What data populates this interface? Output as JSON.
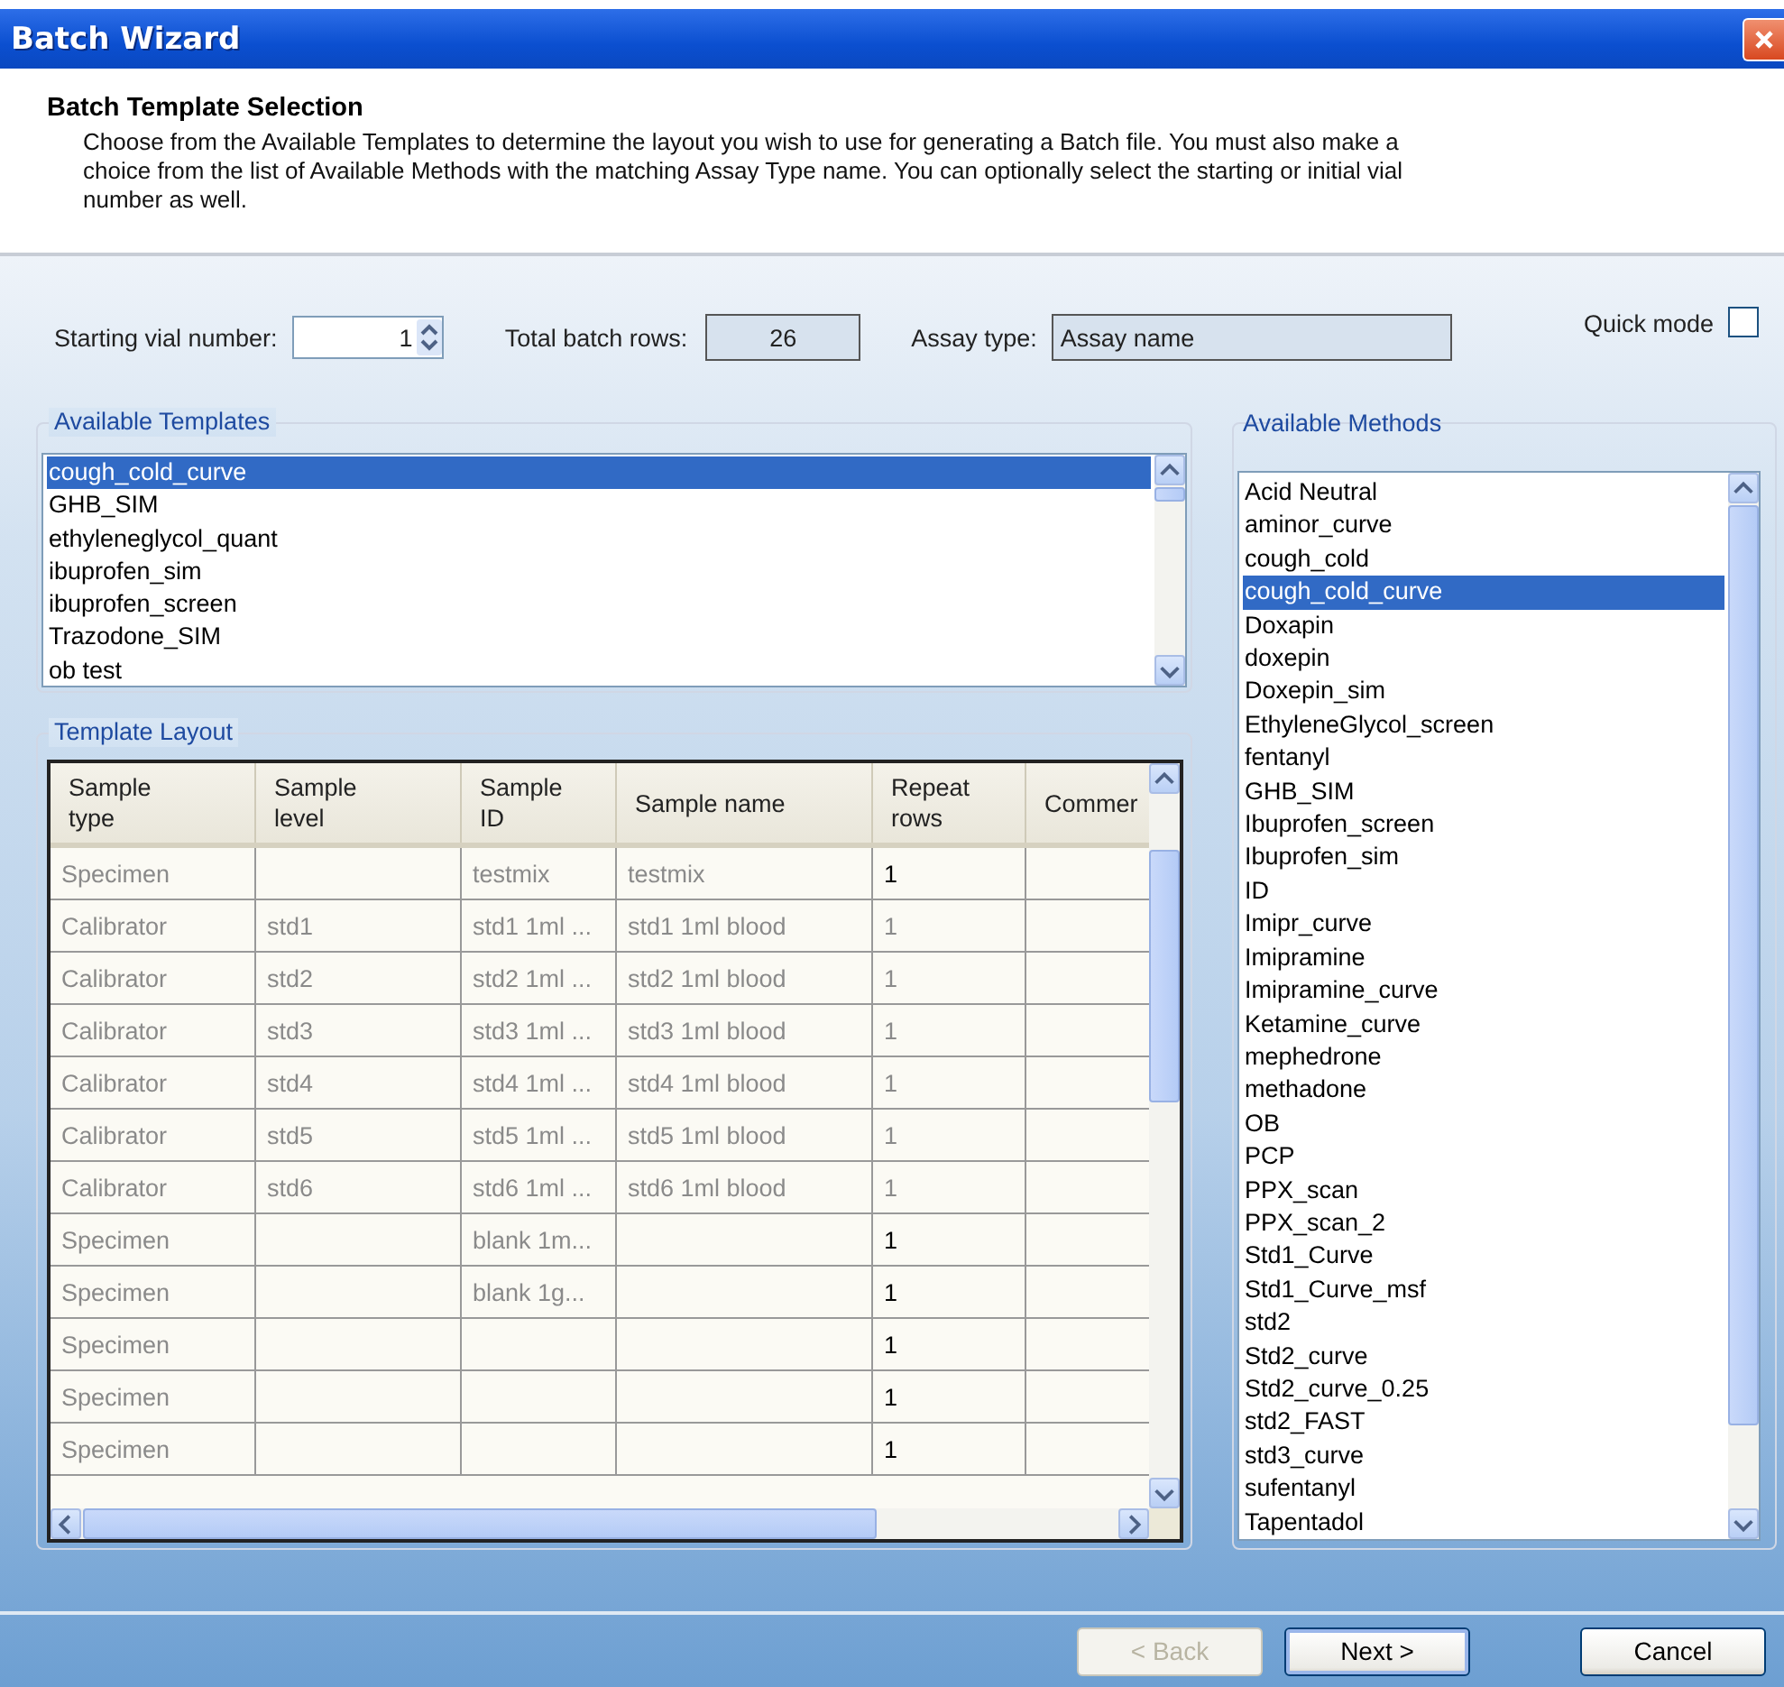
{
  "window": {
    "title": "Batch Wizard"
  },
  "header": {
    "title": "Batch Template Selection",
    "description": "Choose from the Available Templates to determine the layout you wish to use for generating a Batch file.  You must also make a choice from the list of Available Methods with the matching Assay Type name.  You can optionally select the starting or initial vial number as well."
  },
  "settings": {
    "starting_vial_label": "Starting vial number:",
    "starting_vial": "1",
    "total_rows_label": "Total batch rows:",
    "total_rows": "26",
    "assay_type_label": "Assay type:",
    "assay_type": "Assay name",
    "quick_mode_label": "Quick mode",
    "quick_mode_checked": false
  },
  "templates": {
    "label": "Available Templates",
    "items": [
      {
        "label": "cough_cold_curve",
        "selected": true
      },
      {
        "label": "GHB_SIM",
        "selected": false
      },
      {
        "label": "ethyleneglycol_quant",
        "selected": false
      },
      {
        "label": "ibuprofen_sim",
        "selected": false
      },
      {
        "label": "ibuprofen_screen",
        "selected": false
      },
      {
        "label": "Trazodone_SIM",
        "selected": false
      },
      {
        "label": "ob test",
        "selected": false
      }
    ]
  },
  "template_layout": {
    "label": "Template Layout",
    "columns": [
      "Sample type",
      "Sample level",
      "Sample ID",
      "Sample name",
      "Repeat rows",
      "Commer"
    ],
    "rows": [
      {
        "sample_type": "Specimen",
        "sample_id": "testmix",
        "sample_name": "testmix",
        "repeat_rows": "1",
        "editable": true
      },
      {
        "sample_type": "Calibrator",
        "sample_level": "std1",
        "sample_id": "std1 1ml ...",
        "sample_name": "std1 1ml blood",
        "repeat_rows": "1",
        "editable": false
      },
      {
        "sample_type": "Calibrator",
        "sample_level": "std2",
        "sample_id": "std2 1ml ...",
        "sample_name": "std2 1ml blood",
        "repeat_rows": "1",
        "editable": false
      },
      {
        "sample_type": "Calibrator",
        "sample_level": "std3",
        "sample_id": "std3 1ml ...",
        "sample_name": "std3 1ml blood",
        "repeat_rows": "1",
        "editable": false
      },
      {
        "sample_type": "Calibrator",
        "sample_level": "std4",
        "sample_id": "std4 1ml ...",
        "sample_name": "std4 1ml blood",
        "repeat_rows": "1",
        "editable": false
      },
      {
        "sample_type": "Calibrator",
        "sample_level": "std5",
        "sample_id": "std5 1ml ...",
        "sample_name": "std5 1ml blood",
        "repeat_rows": "1",
        "editable": false
      },
      {
        "sample_type": "Calibrator",
        "sample_level": "std6",
        "sample_id": "std6 1ml ...",
        "sample_name": "std6 1ml blood",
        "repeat_rows": "1",
        "editable": false
      },
      {
        "sample_type": "Specimen",
        "sample_id": "blank 1m...",
        "repeat_rows": "1",
        "editable": true
      },
      {
        "sample_type": "Specimen",
        "sample_id": "blank 1g...",
        "repeat_rows": "1",
        "editable": true
      },
      {
        "sample_type": "Specimen",
        "repeat_rows": "1",
        "editable": true
      },
      {
        "sample_type": "Specimen",
        "repeat_rows": "1",
        "editable": true
      },
      {
        "sample_type": "Specimen",
        "repeat_rows": "1",
        "editable": true
      }
    ]
  },
  "methods": {
    "label": "Available Methods",
    "items": [
      {
        "label": "Acid Neutral",
        "selected": false
      },
      {
        "label": "aminor_curve",
        "selected": false
      },
      {
        "label": "cough_cold",
        "selected": false
      },
      {
        "label": "cough_cold_curve",
        "selected": true
      },
      {
        "label": "Doxapin",
        "selected": false
      },
      {
        "label": "doxepin",
        "selected": false
      },
      {
        "label": "Doxepin_sim",
        "selected": false
      },
      {
        "label": "EthyleneGlycol_screen",
        "selected": false
      },
      {
        "label": "fentanyl",
        "selected": false
      },
      {
        "label": "GHB_SIM",
        "selected": false
      },
      {
        "label": "Ibuprofen_screen",
        "selected": false
      },
      {
        "label": "Ibuprofen_sim",
        "selected": false
      },
      {
        "label": "ID",
        "selected": false
      },
      {
        "label": "Imipr_curve",
        "selected": false
      },
      {
        "label": "Imipramine",
        "selected": false
      },
      {
        "label": "Imipramine_curve",
        "selected": false
      },
      {
        "label": "Ketamine_curve",
        "selected": false
      },
      {
        "label": "mephedrone",
        "selected": false
      },
      {
        "label": "methadone",
        "selected": false
      },
      {
        "label": "OB",
        "selected": false
      },
      {
        "label": "PCP",
        "selected": false
      },
      {
        "label": "PPX_scan",
        "selected": false
      },
      {
        "label": "PPX_scan_2",
        "selected": false
      },
      {
        "label": "Std1_Curve",
        "selected": false
      },
      {
        "label": "Std1_Curve_msf",
        "selected": false
      },
      {
        "label": "std2",
        "selected": false
      },
      {
        "label": "Std2_curve",
        "selected": false
      },
      {
        "label": "Std2_curve_0.25",
        "selected": false
      },
      {
        "label": "std2_FAST",
        "selected": false
      },
      {
        "label": "std3_curve",
        "selected": false
      },
      {
        "label": "sufentanyl",
        "selected": false
      },
      {
        "label": "Tapentadol",
        "selected": false
      }
    ]
  },
  "buttons": [
    {
      "label": "< Back",
      "disabled": true,
      "default": false
    },
    {
      "label": "Next >",
      "disabled": false,
      "default": true
    },
    {
      "label": "Cancel",
      "disabled": false,
      "default": false
    }
  ]
}
